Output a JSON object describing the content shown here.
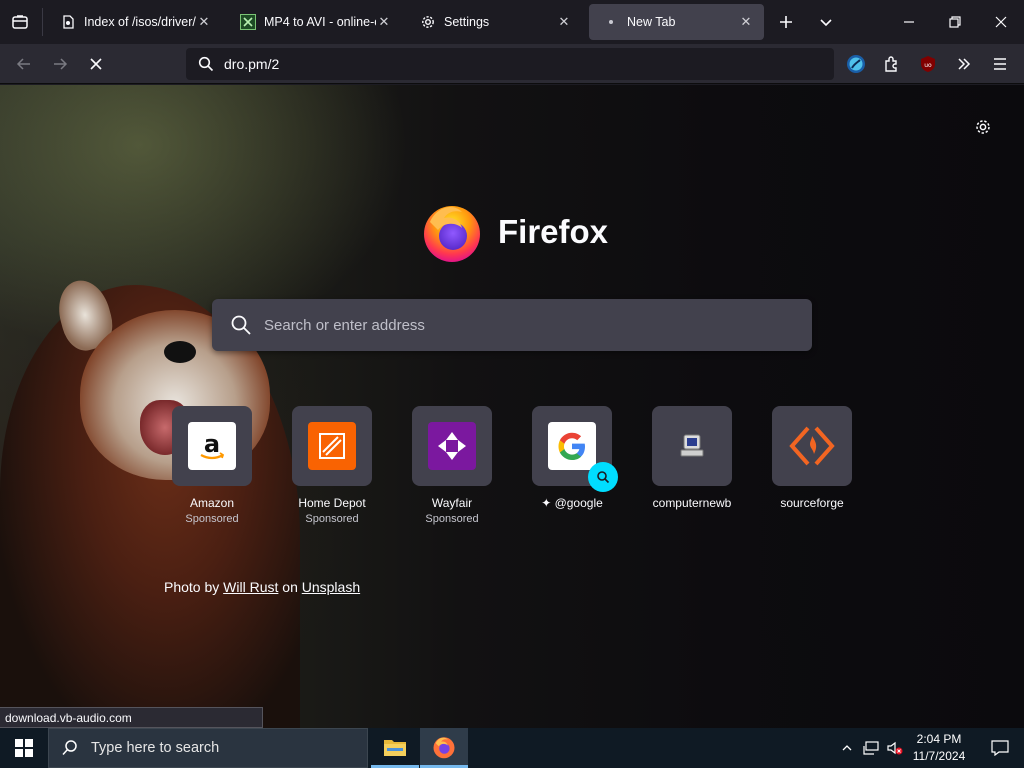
{
  "tabs": [
    {
      "title": "Index of /isos/driver/",
      "icon": "document-server-icon"
    },
    {
      "title": "MP4 to AVI - online-co",
      "icon": "convert-icon"
    },
    {
      "title": "Settings",
      "icon": "gear-icon"
    },
    {
      "title": "New Tab",
      "icon": "loading-dot-icon",
      "active": true
    }
  ],
  "url": "dro.pm/2",
  "newtab": {
    "brand": "Firefox",
    "search_placeholder": "Search or enter address",
    "tiles": [
      {
        "label": "Amazon",
        "sub": "Sponsored",
        "icon": "amazon-icon"
      },
      {
        "label": "Home Depot",
        "sub": "Sponsored",
        "icon": "home-depot-icon"
      },
      {
        "label": "Wayfair",
        "sub": "Sponsored",
        "icon": "wayfair-icon"
      },
      {
        "label": "@google",
        "sub": "",
        "icon": "google-icon"
      },
      {
        "label": "computernewb",
        "sub": "",
        "icon": "computernewb-icon"
      },
      {
        "label": "sourceforge",
        "sub": "",
        "icon": "sourceforge-icon"
      }
    ],
    "credit": {
      "prefix": "Photo by ",
      "author": "Will Rust",
      "middle": " on ",
      "site": "Unsplash"
    }
  },
  "status_url": "download.vb-audio.com",
  "taskbar": {
    "search_placeholder": "Type here to search",
    "time": "2:04 PM",
    "date": "11/7/2024"
  },
  "colors": {
    "accent": "#00ddff",
    "active_tab": "#42414d",
    "toolbar": "#2b2a33"
  }
}
